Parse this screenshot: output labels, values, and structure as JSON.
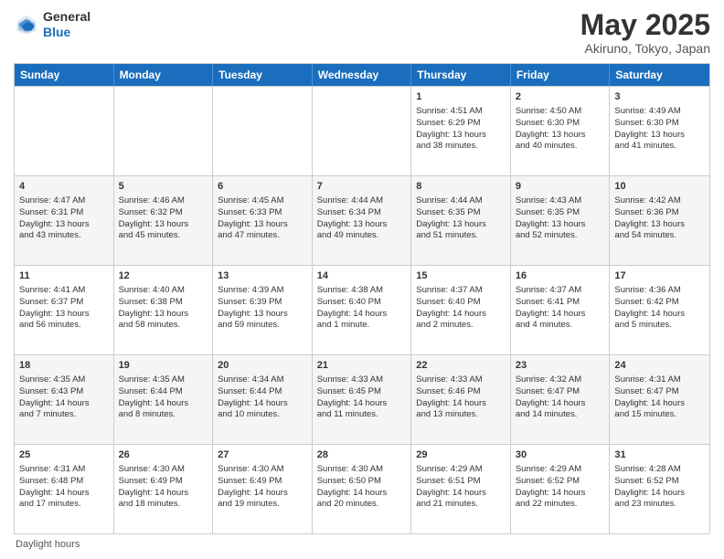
{
  "header": {
    "logo_line1": "General",
    "logo_line2": "Blue",
    "month_title": "May 2025",
    "location": "Akiruno, Tokyo, Japan"
  },
  "weekdays": [
    "Sunday",
    "Monday",
    "Tuesday",
    "Wednesday",
    "Thursday",
    "Friday",
    "Saturday"
  ],
  "footer": {
    "daylight_label": "Daylight hours"
  },
  "weeks": [
    [
      {
        "day": "",
        "info": ""
      },
      {
        "day": "",
        "info": ""
      },
      {
        "day": "",
        "info": ""
      },
      {
        "day": "",
        "info": ""
      },
      {
        "day": "1",
        "info": "Sunrise: 4:51 AM\nSunset: 6:29 PM\nDaylight: 13 hours\nand 38 minutes."
      },
      {
        "day": "2",
        "info": "Sunrise: 4:50 AM\nSunset: 6:30 PM\nDaylight: 13 hours\nand 40 minutes."
      },
      {
        "day": "3",
        "info": "Sunrise: 4:49 AM\nSunset: 6:30 PM\nDaylight: 13 hours\nand 41 minutes."
      }
    ],
    [
      {
        "day": "4",
        "info": "Sunrise: 4:47 AM\nSunset: 6:31 PM\nDaylight: 13 hours\nand 43 minutes."
      },
      {
        "day": "5",
        "info": "Sunrise: 4:46 AM\nSunset: 6:32 PM\nDaylight: 13 hours\nand 45 minutes."
      },
      {
        "day": "6",
        "info": "Sunrise: 4:45 AM\nSunset: 6:33 PM\nDaylight: 13 hours\nand 47 minutes."
      },
      {
        "day": "7",
        "info": "Sunrise: 4:44 AM\nSunset: 6:34 PM\nDaylight: 13 hours\nand 49 minutes."
      },
      {
        "day": "8",
        "info": "Sunrise: 4:44 AM\nSunset: 6:35 PM\nDaylight: 13 hours\nand 51 minutes."
      },
      {
        "day": "9",
        "info": "Sunrise: 4:43 AM\nSunset: 6:35 PM\nDaylight: 13 hours\nand 52 minutes."
      },
      {
        "day": "10",
        "info": "Sunrise: 4:42 AM\nSunset: 6:36 PM\nDaylight: 13 hours\nand 54 minutes."
      }
    ],
    [
      {
        "day": "11",
        "info": "Sunrise: 4:41 AM\nSunset: 6:37 PM\nDaylight: 13 hours\nand 56 minutes."
      },
      {
        "day": "12",
        "info": "Sunrise: 4:40 AM\nSunset: 6:38 PM\nDaylight: 13 hours\nand 58 minutes."
      },
      {
        "day": "13",
        "info": "Sunrise: 4:39 AM\nSunset: 6:39 PM\nDaylight: 13 hours\nand 59 minutes."
      },
      {
        "day": "14",
        "info": "Sunrise: 4:38 AM\nSunset: 6:40 PM\nDaylight: 14 hours\nand 1 minute."
      },
      {
        "day": "15",
        "info": "Sunrise: 4:37 AM\nSunset: 6:40 PM\nDaylight: 14 hours\nand 2 minutes."
      },
      {
        "day": "16",
        "info": "Sunrise: 4:37 AM\nSunset: 6:41 PM\nDaylight: 14 hours\nand 4 minutes."
      },
      {
        "day": "17",
        "info": "Sunrise: 4:36 AM\nSunset: 6:42 PM\nDaylight: 14 hours\nand 5 minutes."
      }
    ],
    [
      {
        "day": "18",
        "info": "Sunrise: 4:35 AM\nSunset: 6:43 PM\nDaylight: 14 hours\nand 7 minutes."
      },
      {
        "day": "19",
        "info": "Sunrise: 4:35 AM\nSunset: 6:44 PM\nDaylight: 14 hours\nand 8 minutes."
      },
      {
        "day": "20",
        "info": "Sunrise: 4:34 AM\nSunset: 6:44 PM\nDaylight: 14 hours\nand 10 minutes."
      },
      {
        "day": "21",
        "info": "Sunrise: 4:33 AM\nSunset: 6:45 PM\nDaylight: 14 hours\nand 11 minutes."
      },
      {
        "day": "22",
        "info": "Sunrise: 4:33 AM\nSunset: 6:46 PM\nDaylight: 14 hours\nand 13 minutes."
      },
      {
        "day": "23",
        "info": "Sunrise: 4:32 AM\nSunset: 6:47 PM\nDaylight: 14 hours\nand 14 minutes."
      },
      {
        "day": "24",
        "info": "Sunrise: 4:31 AM\nSunset: 6:47 PM\nDaylight: 14 hours\nand 15 minutes."
      }
    ],
    [
      {
        "day": "25",
        "info": "Sunrise: 4:31 AM\nSunset: 6:48 PM\nDaylight: 14 hours\nand 17 minutes."
      },
      {
        "day": "26",
        "info": "Sunrise: 4:30 AM\nSunset: 6:49 PM\nDaylight: 14 hours\nand 18 minutes."
      },
      {
        "day": "27",
        "info": "Sunrise: 4:30 AM\nSunset: 6:49 PM\nDaylight: 14 hours\nand 19 minutes."
      },
      {
        "day": "28",
        "info": "Sunrise: 4:30 AM\nSunset: 6:50 PM\nDaylight: 14 hours\nand 20 minutes."
      },
      {
        "day": "29",
        "info": "Sunrise: 4:29 AM\nSunset: 6:51 PM\nDaylight: 14 hours\nand 21 minutes."
      },
      {
        "day": "30",
        "info": "Sunrise: 4:29 AM\nSunset: 6:52 PM\nDaylight: 14 hours\nand 22 minutes."
      },
      {
        "day": "31",
        "info": "Sunrise: 4:28 AM\nSunset: 6:52 PM\nDaylight: 14 hours\nand 23 minutes."
      }
    ]
  ]
}
